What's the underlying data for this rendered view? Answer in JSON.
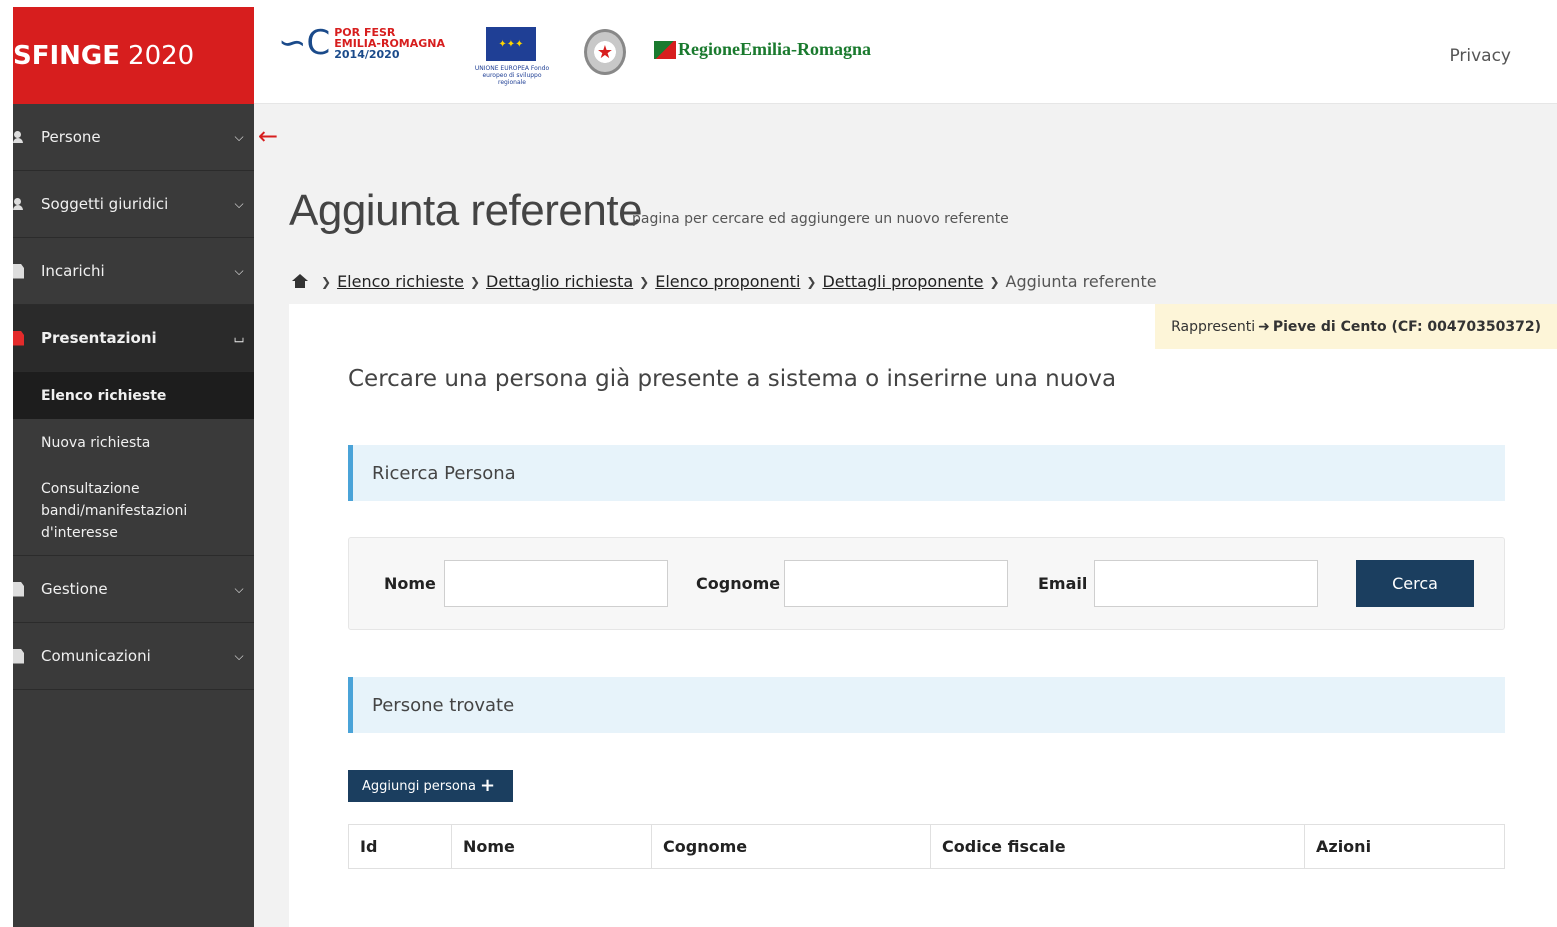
{
  "brand": {
    "bold": "SFINGE",
    "year": "2020"
  },
  "logos": {
    "fesr_line1": "POR FESR",
    "fesr_line2": "EMILIA-ROMAGNA",
    "fesr_line3": "2014/2020",
    "eu_caption": "UNIONE EUROPEA Fondo europeo di sviluppo regionale",
    "regione": "RegioneEmilia-Romagna"
  },
  "topbar": {
    "privacy": "Privacy"
  },
  "sidebar": {
    "items": [
      {
        "label": "Persone",
        "icon": "people-icon"
      },
      {
        "label": "Soggetti giuridici",
        "icon": "people-icon"
      },
      {
        "label": "Incarichi",
        "icon": "file-icon"
      },
      {
        "label": "Presentazioni",
        "icon": "file-icon"
      },
      {
        "label": "Gestione",
        "icon": "file-icon"
      },
      {
        "label": "Comunicazioni",
        "icon": "file-icon"
      }
    ],
    "sub_items": [
      {
        "label": "Elenco richieste"
      },
      {
        "label": "Nuova richiesta"
      },
      {
        "label": "Consultazione bandi/manifestazioni d'interesse"
      }
    ]
  },
  "page": {
    "title": "Aggiunta referente",
    "subtitle": "pagina per cercare ed aggiungere un nuovo referente",
    "breadcrumb": [
      "Elenco richieste",
      "Dettaglio richiesta",
      "Elenco proponenti",
      "Dettagli proponente",
      "Aggiunta referente"
    ],
    "rappresenti_label": "Rappresenti",
    "rappresenti_value": "Pieve di Cento (CF: 00470350372)",
    "intro": "Cercare una persona già presente a sistema o inserirne una nuova"
  },
  "search": {
    "section_title": "Ricerca Persona",
    "nome_label": "Nome",
    "nome_value": "",
    "cognome_label": "Cognome",
    "cognome_value": "",
    "email_label": "Email",
    "email_value": "",
    "button": "Cerca"
  },
  "results": {
    "section_title": "Persone trovate",
    "add_button": "Aggiungi persona",
    "columns": [
      "Id",
      "Nome",
      "Cognome",
      "Codice fiscale",
      "Azioni"
    ],
    "rows": []
  },
  "colors": {
    "brand_red": "#d71e1e",
    "sidebar_bg": "#3a3a3a",
    "primary_button": "#1b3e5f",
    "section_accent": "#4aa3d8",
    "section_bg": "#e7f3fa",
    "rappresenti_bg": "#fdf5d8"
  }
}
